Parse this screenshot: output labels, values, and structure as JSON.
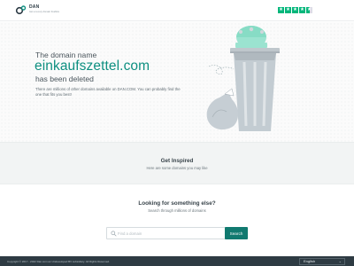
{
  "header": {
    "brand": "DAN",
    "tagline": "Get a Luxury domain freeflow",
    "trust_stars": 4.5
  },
  "hero": {
    "line1": "The domain name",
    "domain": "einkaufszettel.com",
    "line3": "has been deleted",
    "description": "There are millions of other domains available on DAN.COM. You can probably find the one that fits you best!"
  },
  "inspired": {
    "title": "Get Inspired",
    "subtitle": "Here are some domains you may like"
  },
  "search": {
    "title": "Looking for something else?",
    "subtitle": "Search through millions of domains",
    "placeholder": "Find a domain",
    "button_label": "Search"
  },
  "footer": {
    "copyright": "Copyright © 2017 - 2022 Dan.com an Undeveloped BV subsidiary. All Rights Reserved.",
    "language": "English"
  },
  "colors": {
    "accent": "#0d8f80",
    "button": "#117a70",
    "footer": "#2e3b43",
    "trustpilot": "#00b67a"
  }
}
